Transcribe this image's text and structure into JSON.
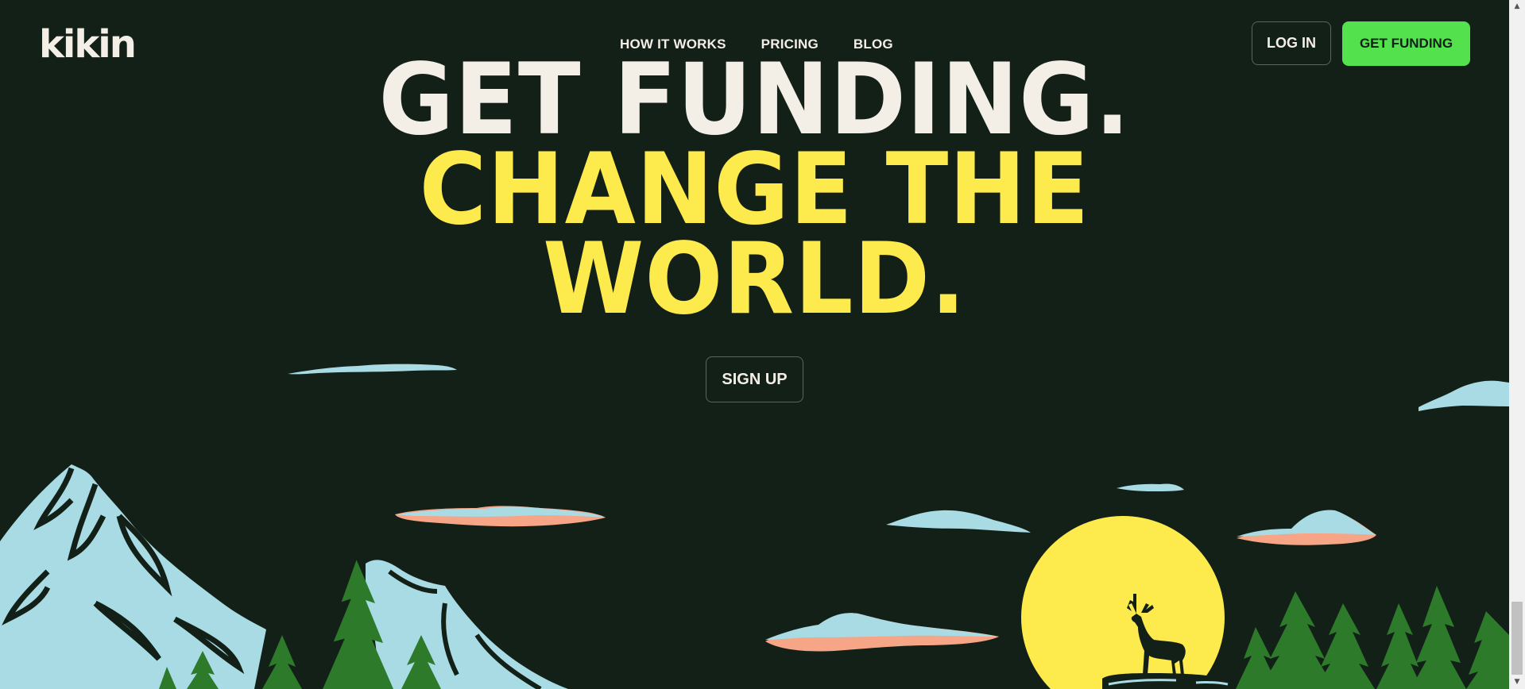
{
  "header": {
    "logo": "kikin",
    "nav": [
      "HOW IT WORKS",
      "PRICING",
      "BLOG"
    ],
    "login_label": "LOG IN",
    "get_funding_label": "GET FUNDING"
  },
  "hero": {
    "line1": "GET FUNDING.",
    "line2": "CHANGE THE",
    "line3": "WORLD.",
    "signup_label": "SIGN UP"
  },
  "colors": {
    "background": "#132018",
    "cream": "#f4efe6",
    "yellow": "#fdea4c",
    "green_button": "#53e14d",
    "sky_blue": "#a8dbe3",
    "salmon": "#f6a587",
    "forest_green": "#2c7a2a"
  },
  "icons": {
    "scroll_up": "scroll-up-arrow-icon",
    "scroll_down": "scroll-down-arrow-icon"
  }
}
